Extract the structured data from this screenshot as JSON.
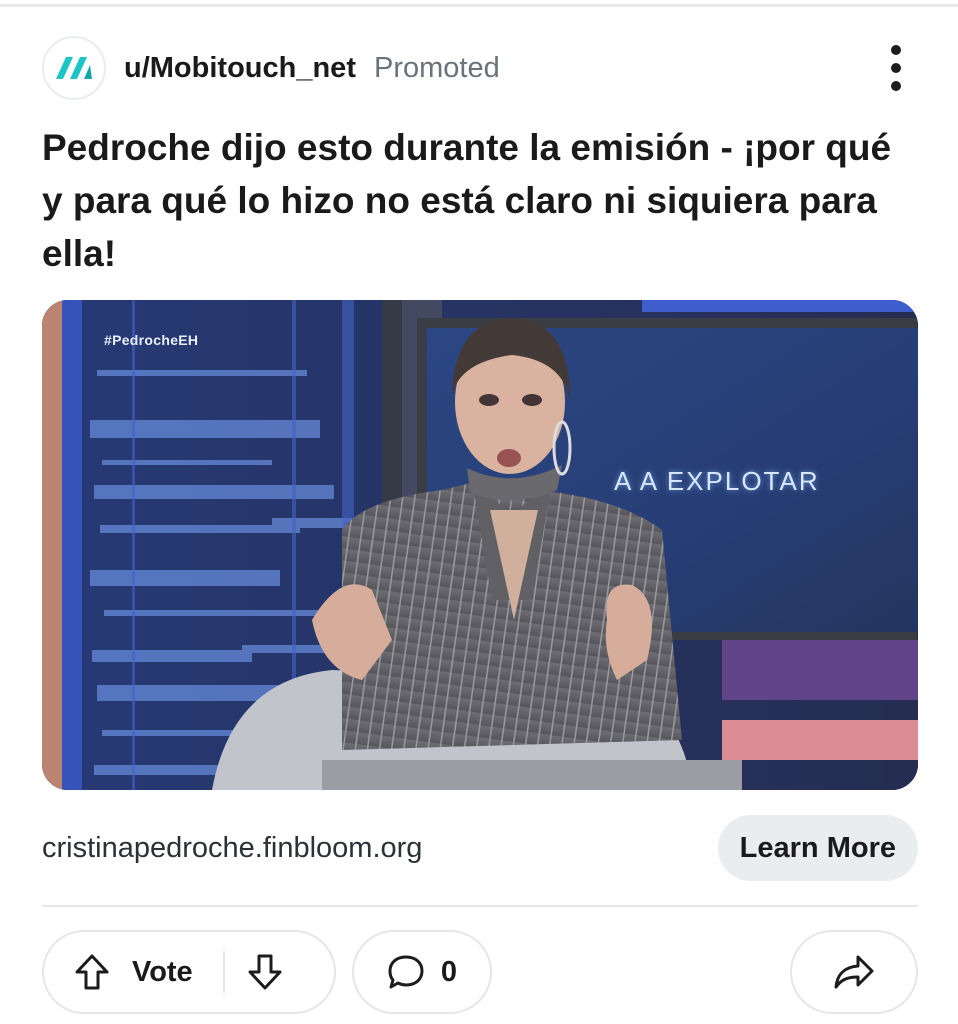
{
  "post": {
    "username": "u/Mobitouch_net",
    "promoted_label": "Promoted",
    "title": "Pedroche dijo esto durante la emisión - ¡por qué y para qué lo hizo no está claro ni siquiera para ella!",
    "media": {
      "hashtag": "#PedrocheEH",
      "screen_text": "A A EXPLOTAR"
    },
    "domain": "cristinapedroche.finbloom.org",
    "cta_label": "Learn More"
  },
  "actions": {
    "vote_label": "Vote",
    "comment_count": "0"
  },
  "icons": {
    "avatar": "mobitouch-logo-icon",
    "more": "more-vertical-icon",
    "upvote": "arrow-up-icon",
    "downvote": "arrow-down-icon",
    "comment": "comment-bubble-icon",
    "share": "share-arrow-icon"
  },
  "colors": {
    "brand_teal": "#1ec5c7",
    "muted_text": "#6a7379",
    "pill_background": "#eaedef",
    "border": "#e4e6e8"
  }
}
